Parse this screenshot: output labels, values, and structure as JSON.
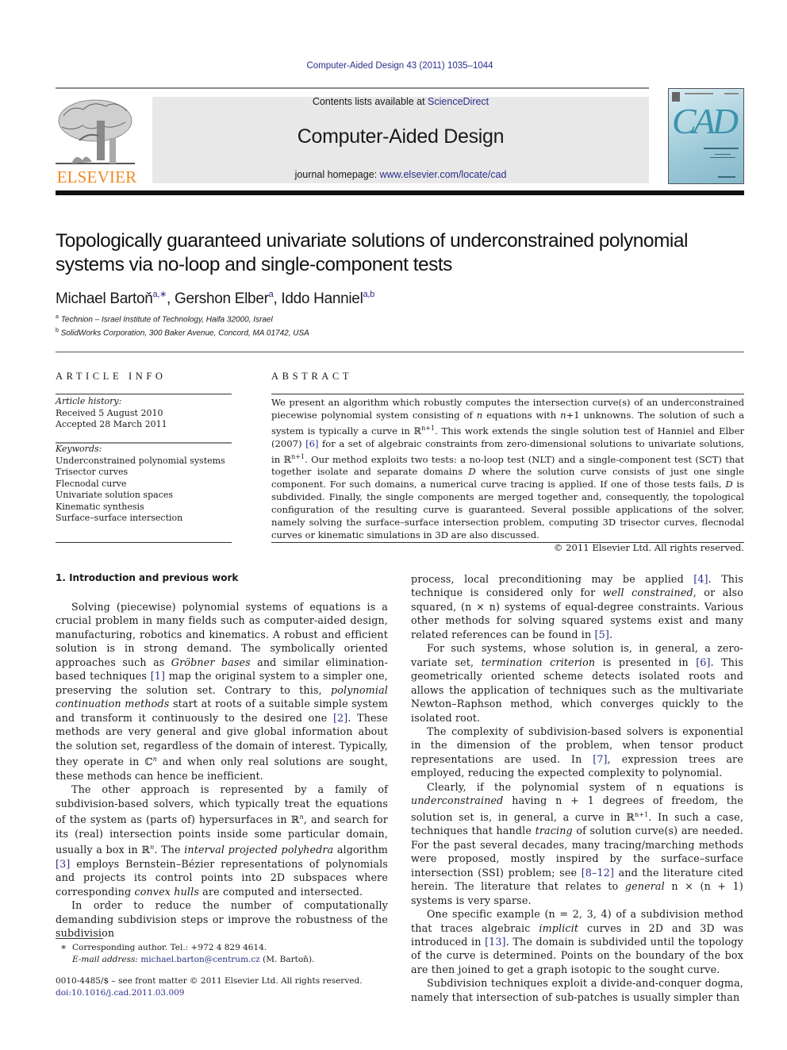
{
  "header": {
    "citation": "Computer-Aided Design 43 (2011) 1035–1044",
    "contents_prefix": "Contents lists available at ",
    "contents_link": "ScienceDirect",
    "journal_title": "Computer-Aided Design",
    "homepage_prefix": "journal homepage: ",
    "homepage_link": "www.elsevier.com/locate/cad",
    "publisher_logo_text": "ELSEVIER",
    "cover_title": "CAD",
    "brand_color": "#f08a24",
    "link_color": "#2b2f8a"
  },
  "article": {
    "title": "Topologically guaranteed univariate solutions of underconstrained polynomial systems via no-loop and single-component tests",
    "authors": [
      {
        "name": "Michael Bartoň",
        "sup": "a,∗"
      },
      {
        "name": "Gershon Elber",
        "sup": "a"
      },
      {
        "name": "Iddo Hanniel",
        "sup": "a,b"
      }
    ],
    "affiliations": [
      {
        "mark": "a",
        "text": "Technion – Israel Institute of Technology, Haifa 32000, Israel"
      },
      {
        "mark": "b",
        "text": "SolidWorks Corporation, 300 Baker Avenue, Concord, MA 01742, USA"
      }
    ]
  },
  "article_info": {
    "heading": "ARTICLE INFO",
    "history_label": "Article history:",
    "received": "Received 5 August 2010",
    "accepted": "Accepted 28 March 2011",
    "keywords_label": "Keywords:",
    "keywords": [
      "Underconstrained polynomial systems",
      "Trisector curves",
      "Flecnodal curve",
      "Univariate solution spaces",
      "Kinematic synthesis",
      "Surface–surface intersection"
    ]
  },
  "abstract": {
    "heading": "ABSTRACT",
    "p1": "We present an algorithm which robustly computes the intersection curve(s) of an underconstrained piecewise polynomial system consisting of ",
    "p2": " equations with ",
    "p3": "+1 unknowns. The solution of such a system is typically a curve in ",
    "p4": ". This work extends the single solution test of Hanniel and Elber (2007) ",
    "ref6": "[6]",
    "p5": " for a set of algebraic constraints from zero-dimensional solutions to univariate solutions, in ",
    "p6": ". Our method exploits two tests: a no-loop test (NLT) and a single-component test (SCT) that together isolate and separate domains ",
    "p7": " where the solution curve consists of just one single component. For such domains, a numerical curve tracing is applied. If one of those tests fails, ",
    "p8": " is subdivided. Finally, the single components are merged together and, consequently, the topological configuration of the resulting curve is guaranteed. Several possible applications of the solver, namely solving the surface–surface intersection problem, computing 3D trisector curves, flecnodal curves or kinematic simulations in 3D are also discussed.",
    "copyright": "© 2011 Elsevier Ltd. All rights reserved.",
    "var_n": "n",
    "var_D": "D",
    "space_Rn1": "ℝ",
    "sup_n1": "n+1"
  },
  "section": {
    "heading": "1.  Introduction and previous work"
  },
  "body": {
    "left": {
      "p1a": "Solving (piecewise) polynomial systems of equations is a crucial problem in many fields such as computer-aided design, manufacturing, robotics and kinematics. A robust and efficient solution is in strong demand. The symbolically oriented approaches such as ",
      "p1_em1": "Gröbner bases",
      "p1b": " and similar elimination-based techniques ",
      "ref1": "[1]",
      "p1c": " map the original system to a simpler one, preserving the solution set. Contrary to this, ",
      "p1_em2": "polynomial continuation methods",
      "p1d": " start at roots of a suitable simple system and transform it continuously to the desired one ",
      "ref2": "[2]",
      "p1e": ". These methods are very general and give global information about the solution set, regardless of the domain of interest. Typically, they operate in ",
      "C": "ℂ",
      "p1f": " and when only real solutions are sought, these methods can hence be inefficient.",
      "p2a": "The other approach is represented by a family of subdivision-based solvers, which typically treat the equations of the system as (parts of) hypersurfaces in ",
      "R": "ℝ",
      "p2b": ", and search for its (real) intersection points inside some particular domain, usually a box in ",
      "p2c": ". The ",
      "p2_em1": "interval projected polyhedra",
      "p2d": " algorithm ",
      "ref3": "[3]",
      "p2e": " employs Bernstein–Bézier representations of polynomials and projects its control points into 2D subspaces where corresponding ",
      "p2_em2": "convex hulls",
      "p2f": " are computed and intersected.",
      "p3": "In order to reduce the number of computationally demanding subdivision steps or improve the robustness of the subdivision",
      "n": "n"
    },
    "right": {
      "p0a": "process, local preconditioning may be applied ",
      "ref4": "[4]",
      "p0b": ". This technique is considered only for ",
      "p0_em": "well constrained",
      "p0c": ", or also squared, (n × n) systems of equal-degree constraints. Various other methods for solving squared systems exist and many related references can be found in ",
      "ref5": "[5]",
      "p0d": ".",
      "p1a": "For such systems, whose solution is, in general, a zero-variate set, ",
      "p1_em": "termination criterion",
      "p1b": " is presented in ",
      "ref6": "[6]",
      "p1c": ". This geometrically oriented scheme detects isolated roots and allows the application of techniques such as the multivariate Newton–Raphson method, which converges quickly to the isolated root.",
      "p2a": "The complexity of subdivision-based solvers is exponential in the dimension of the problem, when tensor product representations are used. In ",
      "ref7": "[7]",
      "p2b": ", expression trees are employed, reducing the expected complexity to polynomial.",
      "p3a": "Clearly, if the polynomial system of n equations is ",
      "p3_em1": "underconstrained",
      "p3b": " having n + 1 degrees of freedom, the solution set is, in general, a curve in ℝ",
      "p3_sup": "n+1",
      "p3c": ". In such a case, techniques that handle ",
      "p3_em2": "tracing",
      "p3d": " of solution curve(s) are needed. For the past several decades, many tracing/marching methods were proposed, mostly inspired by the surface–surface intersection (SSI) problem; see ",
      "ref812": "[8–12]",
      "p3e": " and the literature cited herein. The literature that relates to ",
      "p3_em3": "general",
      "p3f": " n × (n + 1) systems is very sparse.",
      "p4a": "One specific example (n = 2, 3, 4) of a subdivision method that traces algebraic ",
      "p4_em": "implicit",
      "p4b": " curves in 2D and 3D was introduced in ",
      "ref13": "[13]",
      "p4c": ". The domain is subdivided until the topology of the curve is determined. Points on the boundary of the box are then joined to get a graph isotopic to the sought curve.",
      "p5": "Subdivision techniques exploit a divide-and-conquer dogma, namely that intersection of sub-patches is usually simpler than"
    }
  },
  "footnote": {
    "mark": "∗",
    "line1": "Corresponding author. Tel.: +972 4 829 4614.",
    "email_label": "E-mail address: ",
    "email": "michael.barton@centrum.cz",
    "email_suffix": " (M. Bartoň)."
  },
  "frontmatter": {
    "issn": "0010-4485/$ – see front matter © 2011 Elsevier Ltd. All rights reserved.",
    "doi": "doi:10.1016/j.cad.2011.03.009"
  }
}
